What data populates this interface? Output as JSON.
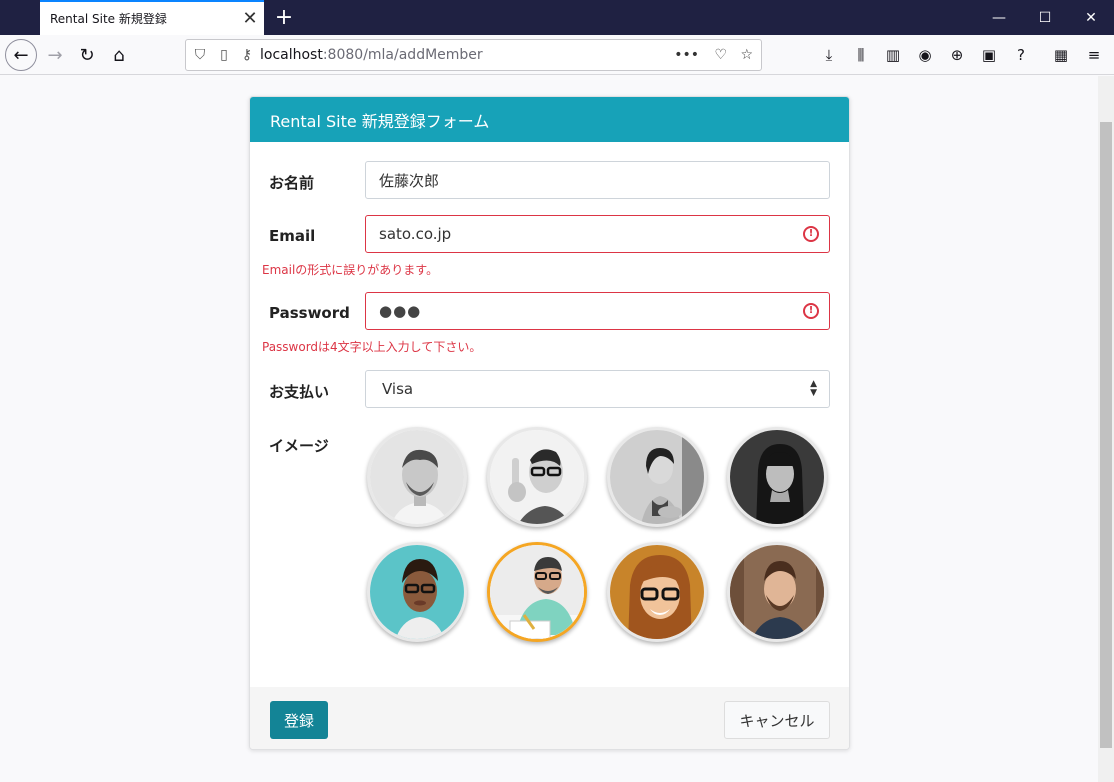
{
  "browser": {
    "tab_title": "Rental Site 新規登録",
    "url_host": "localhost",
    "url_path": ":8080/mla/addMember"
  },
  "form": {
    "header": "Rental Site 新規登録フォーム",
    "name_label": "お名前",
    "name_value": "佐藤次郎",
    "email_label": "Email",
    "email_value": "sato.co.jp",
    "email_error": "Emailの形式に誤りがあります。",
    "password_label": "Password",
    "password_value": "●●●",
    "password_error": "Passwordは4文字以上入力して下さい。",
    "payment_label": "お支払い",
    "payment_value": "Visa",
    "image_label": "イメージ",
    "selected_avatar_index": 5,
    "submit_label": "登録",
    "cancel_label": "キャンセル"
  },
  "colors": {
    "header": "#17a2b8",
    "error": "#dc3545",
    "selected_avatar": "#f5a623",
    "submit": "#138496"
  }
}
